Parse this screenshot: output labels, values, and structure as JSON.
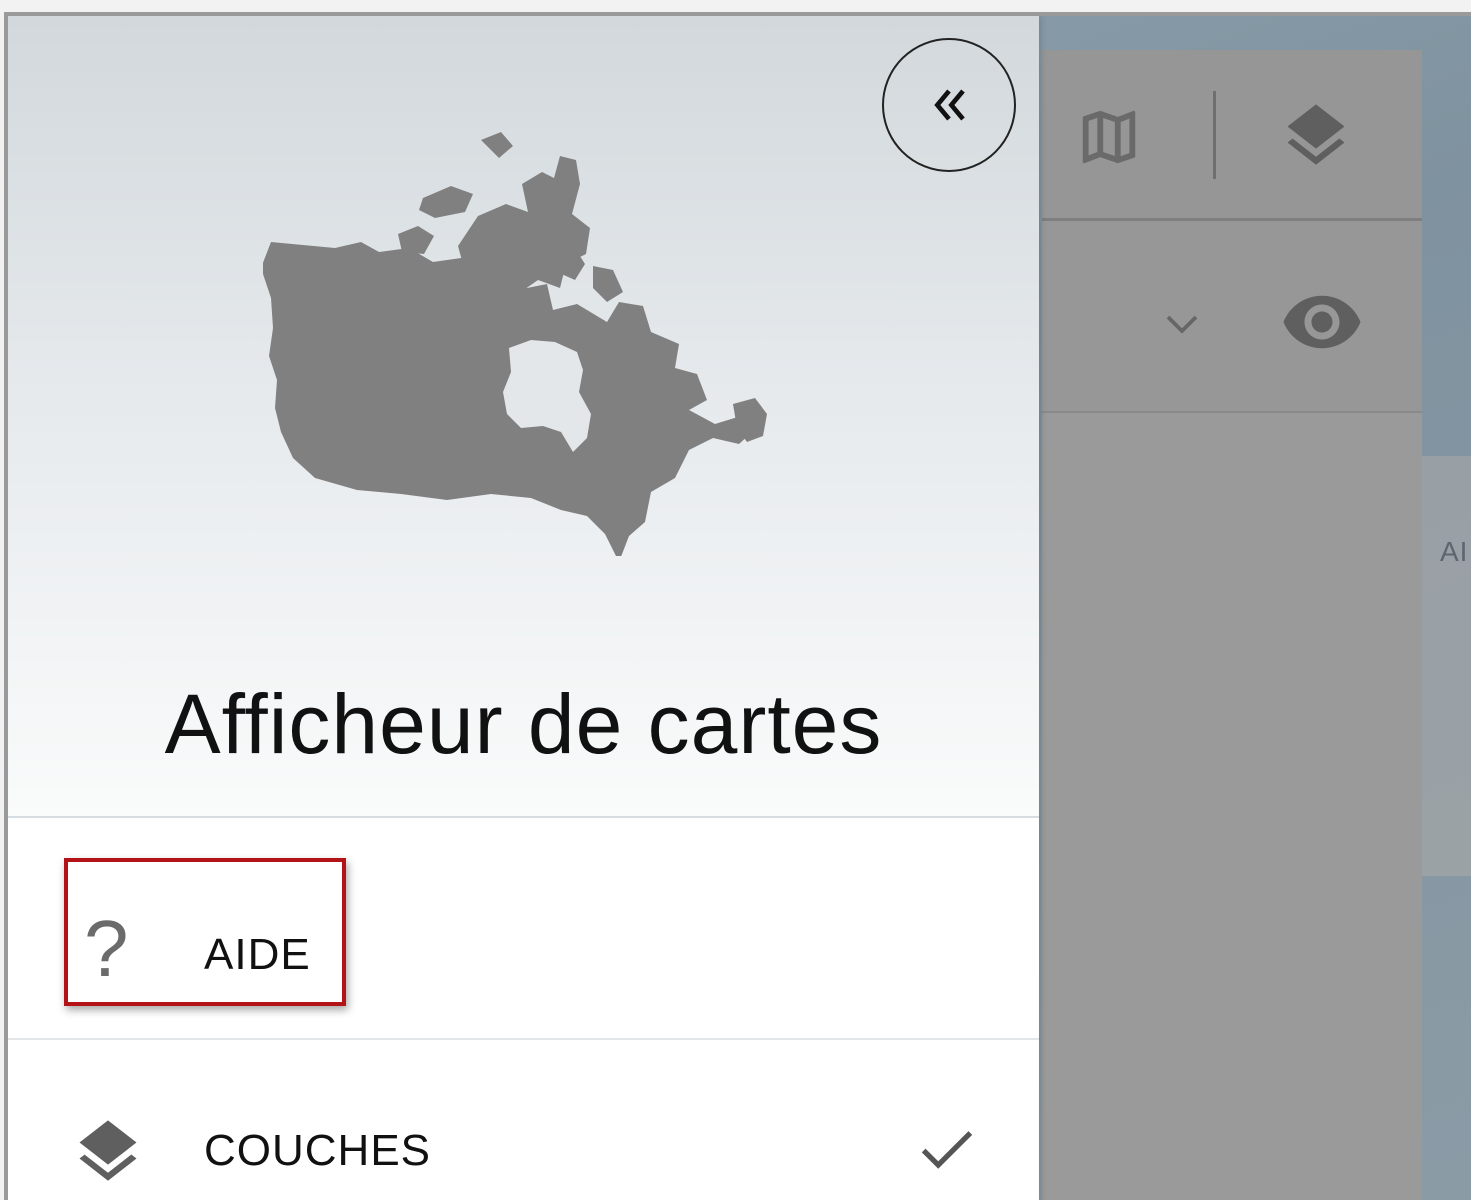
{
  "drawer": {
    "title": "Afficheur de cartes",
    "collapse_icon": "double-chevron-left-icon",
    "logo": "canada-map-logo",
    "menu": [
      {
        "label": "AIDE",
        "icon": "help-question-icon",
        "highlighted": true
      },
      {
        "label": "COUCHES",
        "icon": "layers-icon",
        "selected": true,
        "status_icon": "check-icon"
      }
    ]
  },
  "background_panel": {
    "toolbar_icons": [
      "map-icon",
      "layers-icon"
    ],
    "row_icons": [
      "chevron-down-icon",
      "eye-icon"
    ]
  },
  "map": {
    "partial_label": "AI"
  },
  "colors": {
    "highlight_border": "#b31217",
    "logo_gray": "#808080",
    "scrim": "#9a9a9a"
  }
}
